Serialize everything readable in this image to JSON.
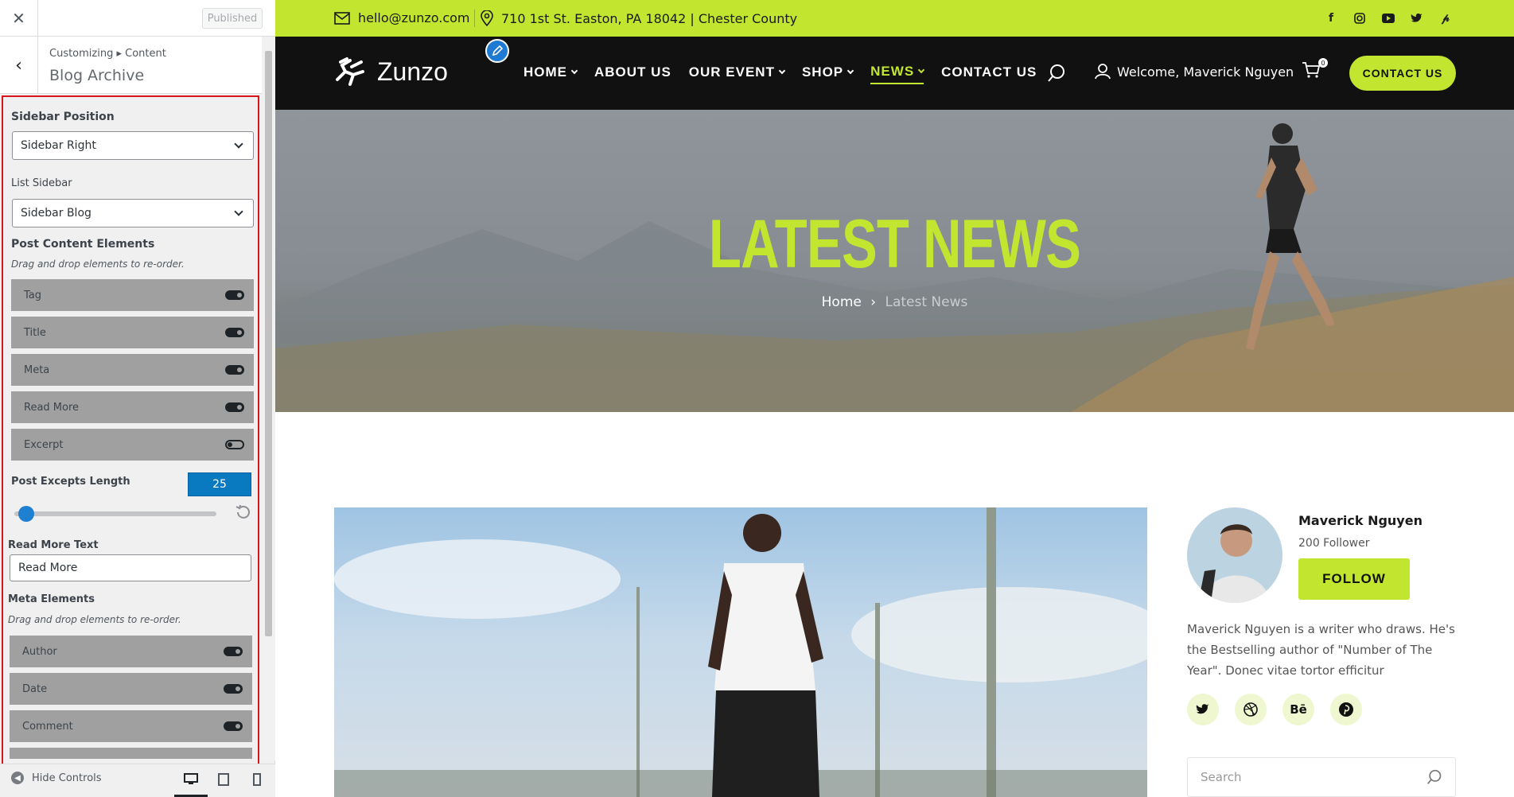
{
  "panel": {
    "close_icon": "close-icon",
    "publish_label": "Published",
    "breadcrumb": "Customizing ▸ Content",
    "section_title": "Blog Archive",
    "sidebar_position": {
      "label": "Sidebar Position",
      "value": "Sidebar Right"
    },
    "list_sidebar": {
      "label": "List Sidebar",
      "value": "Sidebar Blog"
    },
    "post_content": {
      "label": "Post Content Elements",
      "description": "Drag and drop elements to re-order.",
      "items": [
        {
          "label": "Tag",
          "enabled": true
        },
        {
          "label": "Title",
          "enabled": true
        },
        {
          "label": "Meta",
          "enabled": true
        },
        {
          "label": "Read More",
          "enabled": true
        },
        {
          "label": "Excerpt",
          "enabled": false
        }
      ]
    },
    "excerpt_length": {
      "label": "Post Excepts Length",
      "value": "25",
      "slider_fraction": 0.05
    },
    "read_more_text": {
      "label": "Read More Text",
      "value": "Read More"
    },
    "meta_elements": {
      "label": "Meta Elements",
      "description": "Drag and drop elements to re-order.",
      "items": [
        {
          "label": "Author",
          "enabled": true
        },
        {
          "label": "Date",
          "enabled": true
        },
        {
          "label": "Comment",
          "enabled": true
        }
      ]
    },
    "footer": {
      "hide_controls": "Hide Controls",
      "devices": [
        "desktop-icon",
        "tablet-icon",
        "mobile-icon"
      ]
    }
  },
  "site": {
    "topbar": {
      "email": "hello@zunzo.com",
      "address": "710 1st St. Easton, PA 18042 | Chester County",
      "social": [
        "facebook-icon",
        "instagram-icon",
        "youtube-icon",
        "twitter-icon",
        "pinterest-icon"
      ]
    },
    "logo_text": "Zunzo",
    "nav": [
      {
        "label": "HOME",
        "dropdown": true
      },
      {
        "label": "ABOUT US",
        "dropdown": false
      },
      {
        "label": "OUR EVENT",
        "dropdown": true
      },
      {
        "label": "SHOP",
        "dropdown": true
      },
      {
        "label": "NEWS",
        "dropdown": true,
        "active": true
      },
      {
        "label": "CONTACT US",
        "dropdown": false
      }
    ],
    "welcome": "Welcome, Maverick Nguyen",
    "cart_count": "0",
    "contact_button": "CONTACT US",
    "hero": {
      "title": "LATEST NEWS",
      "crumb_home": "Home",
      "crumb_current": "Latest News"
    },
    "author": {
      "name": "Maverick Nguyen",
      "followers": "200 Follower",
      "follow_button": "FOLLOW",
      "bio": "Maverick Nguyen is a writer who draws. He's the Bestselling author of \"Number of The Year\". Donec vitae tortor efficitur",
      "social": [
        "twitter-icon",
        "dribbble-icon",
        "behance-icon",
        "pinterest-icon"
      ],
      "behance_text": "Bē"
    },
    "search_placeholder": "Search"
  },
  "colors": {
    "accent": "#c2e530",
    "dark": "#111111",
    "highlight_border": "#d9141d",
    "wp_blue": "#0a7ac0"
  }
}
